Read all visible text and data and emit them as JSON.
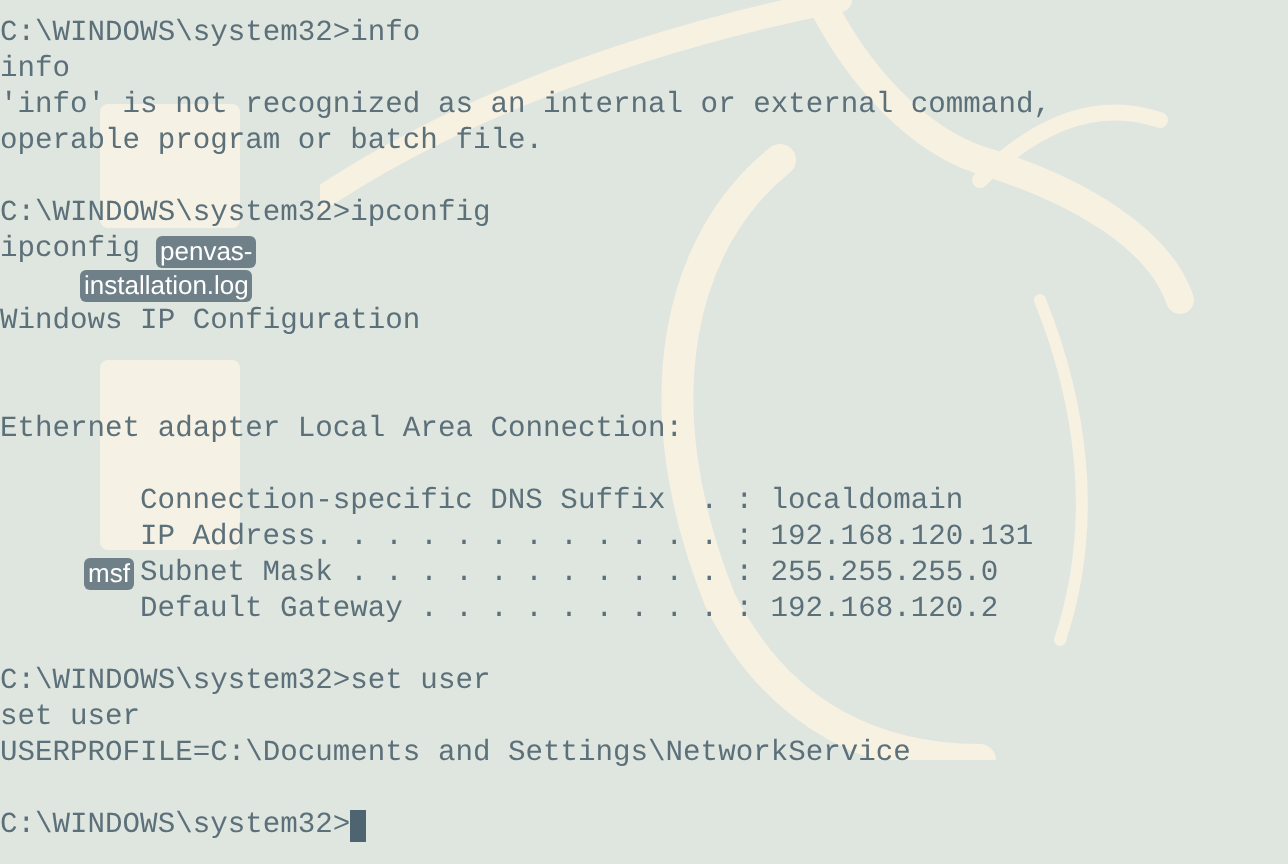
{
  "desktop_icons": [
    {
      "labels": [
        "penvas-",
        "installation.log"
      ]
    },
    {
      "labels": [
        "msf"
      ]
    }
  ],
  "terminal": {
    "lines": [
      {
        "kind": "text",
        "text": "C:\\WINDOWS\\system32>info"
      },
      {
        "kind": "text",
        "text": "info"
      },
      {
        "kind": "text",
        "text": "'info' is not recognized as an internal or external command,"
      },
      {
        "kind": "text",
        "text": "operable program or batch file."
      },
      {
        "kind": "blank"
      },
      {
        "kind": "text",
        "text": "C:\\WINDOWS\\system32>ipconfig"
      },
      {
        "kind": "text",
        "text": "ipconfig"
      },
      {
        "kind": "blank"
      },
      {
        "kind": "text",
        "text": "Windows IP Configuration"
      },
      {
        "kind": "blank"
      },
      {
        "kind": "blank"
      },
      {
        "kind": "text",
        "text": "Ethernet adapter Local Area Connection:"
      },
      {
        "kind": "blank"
      },
      {
        "kind": "indented",
        "text": "Connection-specific DNS Suffix  . : localdomain"
      },
      {
        "kind": "indented",
        "text": "IP Address. . . . . . . . . . . . : 192.168.120.131"
      },
      {
        "kind": "indented",
        "text": "Subnet Mask . . . . . . . . . . . : 255.255.255.0"
      },
      {
        "kind": "indented",
        "text": "Default Gateway . . . . . . . . . : 192.168.120.2"
      },
      {
        "kind": "blank"
      },
      {
        "kind": "text",
        "text": "C:\\WINDOWS\\system32>set user"
      },
      {
        "kind": "text",
        "text": "set user"
      },
      {
        "kind": "text",
        "text": "USERPROFILE=C:\\Documents and Settings\\NetworkService"
      },
      {
        "kind": "blank"
      },
      {
        "kind": "prompt",
        "text": "C:\\WINDOWS\\system32>"
      }
    ]
  }
}
